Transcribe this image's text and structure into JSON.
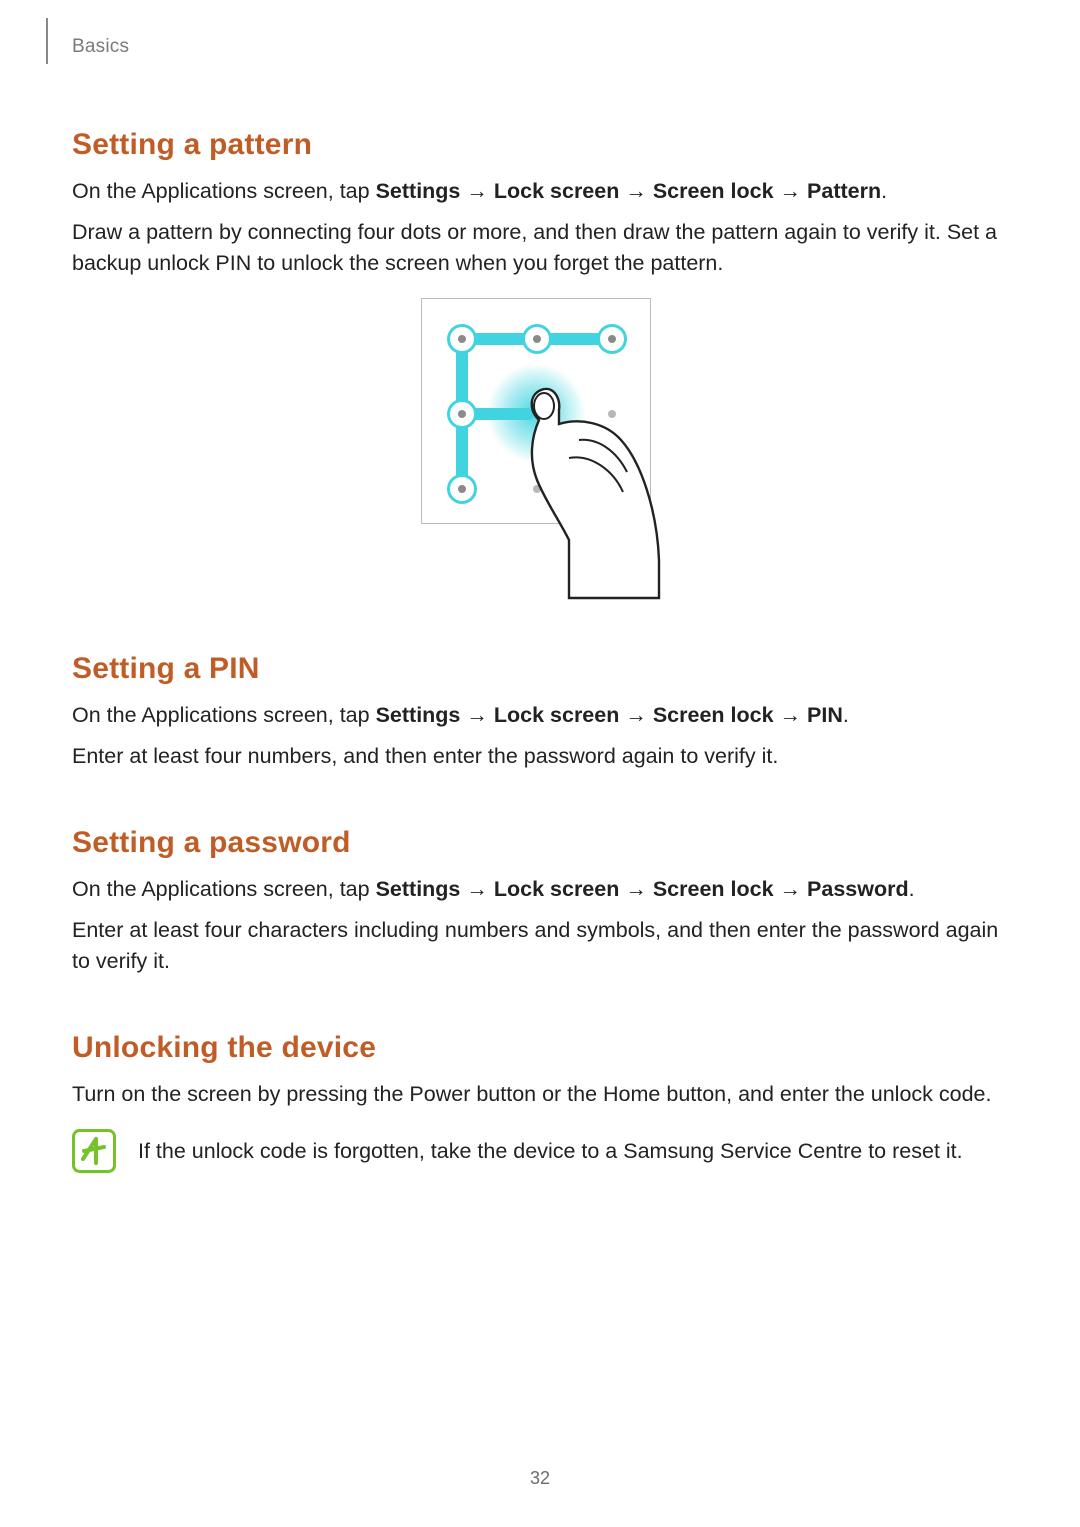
{
  "header": {
    "breadcrumb": "Basics"
  },
  "arrow": "→",
  "sections": {
    "pattern": {
      "title": "Setting a pattern",
      "nav_prefix": "On the Applications screen, tap ",
      "nav_items": [
        "Settings",
        "Lock screen",
        "Screen lock",
        "Pattern"
      ],
      "nav_suffix": ".",
      "body": "Draw a pattern by connecting four dots or more, and then draw the pattern again to verify it. Set a backup unlock PIN to unlock the screen when you forget the pattern."
    },
    "pin": {
      "title": "Setting a PIN",
      "nav_prefix": "On the Applications screen, tap ",
      "nav_items": [
        "Settings",
        "Lock screen",
        "Screen lock",
        "PIN"
      ],
      "nav_suffix": ".",
      "body": "Enter at least four numbers, and then enter the password again to verify it."
    },
    "password": {
      "title": "Setting a password",
      "nav_prefix": "On the Applications screen, tap ",
      "nav_items": [
        "Settings",
        "Lock screen",
        "Screen lock",
        "Password"
      ],
      "nav_suffix": ".",
      "body": "Enter at least four characters including numbers and symbols, and then enter the password again to verify it."
    },
    "unlock": {
      "title": "Unlocking the device",
      "body": "Turn on the screen by pressing the Power button or the Home button, and enter the unlock code.",
      "note": "If the unlock code is forgotten, take the device to a Samsung Service Centre to reset it."
    }
  },
  "page_number": "32",
  "colors": {
    "heading": "#c05d26",
    "accent": "#41d4e0",
    "note_icon": "#76c22a"
  }
}
